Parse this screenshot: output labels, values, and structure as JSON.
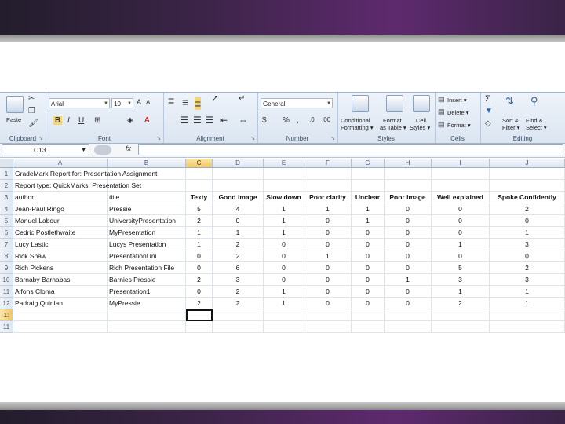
{
  "ribbon": {
    "clipboard": {
      "paste_label": "Paste",
      "group_label": "Clipboard"
    },
    "font": {
      "font_name": "Arial",
      "font_size": "10",
      "group_label": "Font"
    },
    "alignment": {
      "group_label": "Alignment"
    },
    "number": {
      "format": "General",
      "group_label": "Number"
    },
    "styles": {
      "conditional_label_1": "Conditional",
      "conditional_label_2": "Formatting ▾",
      "format_table_1": "Format",
      "format_table_2": "as Table ▾",
      "cell_styles_1": "Cell",
      "cell_styles_2": "Styles ▾",
      "group_label": "Styles"
    },
    "cells": {
      "insert_label": "Insert ▾",
      "delete_label": "Delete ▾",
      "format_label": "Format ▾",
      "group_label": "Cells"
    },
    "editing": {
      "sort_1": "Sort &",
      "sort_2": "Filter ▾",
      "find_1": "Find &",
      "find_2": "Select ▾",
      "group_label": "Editing"
    }
  },
  "formula_bar": {
    "name_box": "C13",
    "fx": "fx",
    "content": ""
  },
  "grid": {
    "columns": [
      "A",
      "B",
      "C",
      "D",
      "E",
      "F",
      "G",
      "H",
      "I",
      "J"
    ],
    "rows": [
      {
        "n": "1",
        "cells": [
          "GradeMark Report for: Presentation Assignment",
          "",
          "",
          "",
          "",
          "",
          "",
          "",
          "",
          ""
        ]
      },
      {
        "n": "2",
        "cells": [
          "Report type: QuickMarks: Presentation Set",
          "",
          "",
          "",
          "",
          "",
          "",
          "",
          "",
          ""
        ]
      },
      {
        "n": "3",
        "cells": [
          "author",
          "title",
          "Texty",
          "Good image",
          "Slow down",
          "Poor clarity",
          "Unclear",
          "Poor image",
          "Well explained",
          "Spoke Confidently"
        ]
      },
      {
        "n": "4",
        "cells": [
          "Jean-Paul Ringo",
          "Pressie",
          "5",
          "4",
          "1",
          "1",
          "1",
          "0",
          "0",
          "2"
        ]
      },
      {
        "n": "5",
        "cells": [
          "Manuel Labour",
          "UniversityPresentation",
          "2",
          "0",
          "1",
          "0",
          "1",
          "0",
          "0",
          "0"
        ]
      },
      {
        "n": "6",
        "cells": [
          "Cedric Postlethwaite",
          "MyPresentation",
          "1",
          "1",
          "1",
          "0",
          "0",
          "0",
          "0",
          "1"
        ]
      },
      {
        "n": "7",
        "cells": [
          "Lucy Lastic",
          "Lucys Presentation",
          "1",
          "2",
          "0",
          "0",
          "0",
          "0",
          "1",
          "3"
        ]
      },
      {
        "n": "8",
        "cells": [
          "Rick Shaw",
          "PresentationUni",
          "0",
          "2",
          "0",
          "1",
          "0",
          "0",
          "0",
          "0"
        ]
      },
      {
        "n": "9",
        "cells": [
          "Rich Pickens",
          "Rich Presentation File",
          "0",
          "6",
          "0",
          "0",
          "0",
          "0",
          "5",
          "2"
        ]
      },
      {
        "n": "10",
        "cells": [
          "Barnaby Barnabas",
          "Barnies Pressie",
          "2",
          "3",
          "0",
          "0",
          "0",
          "1",
          "3",
          "3"
        ]
      },
      {
        "n": "11",
        "cells": [
          "Alfons Cloma",
          "Presentation1",
          "0",
          "2",
          "1",
          "0",
          "0",
          "0",
          "1",
          "1"
        ]
      },
      {
        "n": "12",
        "cells": [
          "Padraig Quinlan",
          "MyPressie",
          "2",
          "2",
          "1",
          "0",
          "0",
          "0",
          "2",
          "1"
        ]
      },
      {
        "n": "13",
        "cells": [
          "",
          "",
          "",
          "",
          "",
          "",
          "",
          "",
          "",
          ""
        ]
      },
      {
        "n": "14",
        "cells": [
          "",
          "",
          "",
          "",
          "",
          "",
          "",
          "",
          "",
          ""
        ]
      }
    ],
    "row_labels_display": [
      "1",
      "2",
      "3",
      "4",
      "5",
      "6",
      "7",
      "8",
      "9",
      "10",
      "11",
      "12",
      "1:",
      "11"
    ]
  }
}
